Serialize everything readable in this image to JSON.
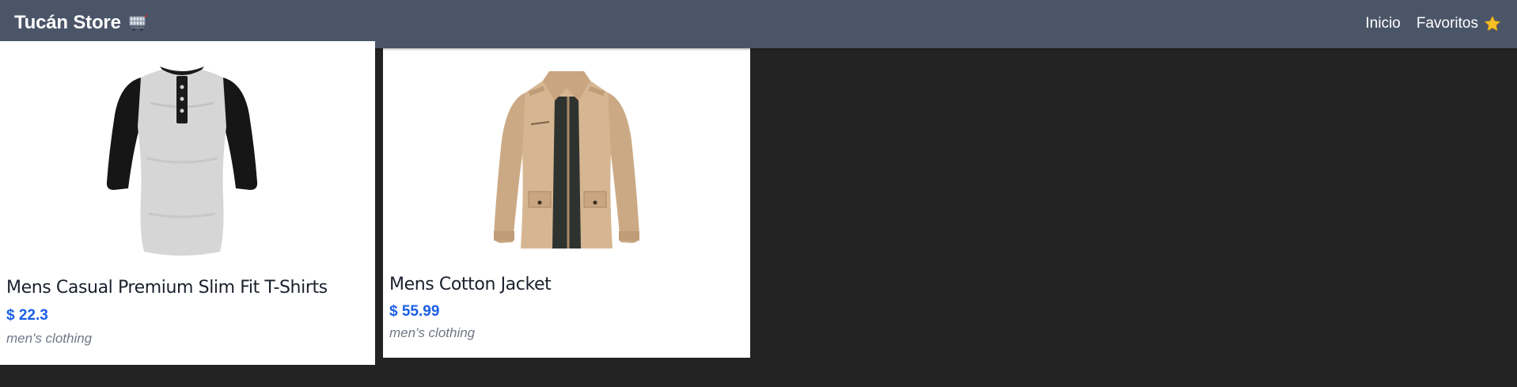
{
  "navbar": {
    "brand": "Tucán Store",
    "brand_icon": "shopping-cart-icon",
    "links": [
      {
        "label": "Inicio"
      },
      {
        "label": "Favoritos",
        "icon": "star-icon"
      }
    ]
  },
  "products": [
    {
      "title": "Mens Casual Premium Slim Fit T-Shirts",
      "price": "$ 22.3",
      "category": "men's clothing",
      "image": "henley-shirt-image"
    },
    {
      "title": "Mens Cotton Jacket",
      "price": "$ 55.99",
      "category": "men's clothing",
      "image": "cotton-jacket-image"
    }
  ],
  "colors": {
    "navbar_bg": "#4a5568",
    "page_bg": "#232323",
    "price": "#1a5fe6",
    "category": "#707785",
    "star": "#f6c026"
  }
}
